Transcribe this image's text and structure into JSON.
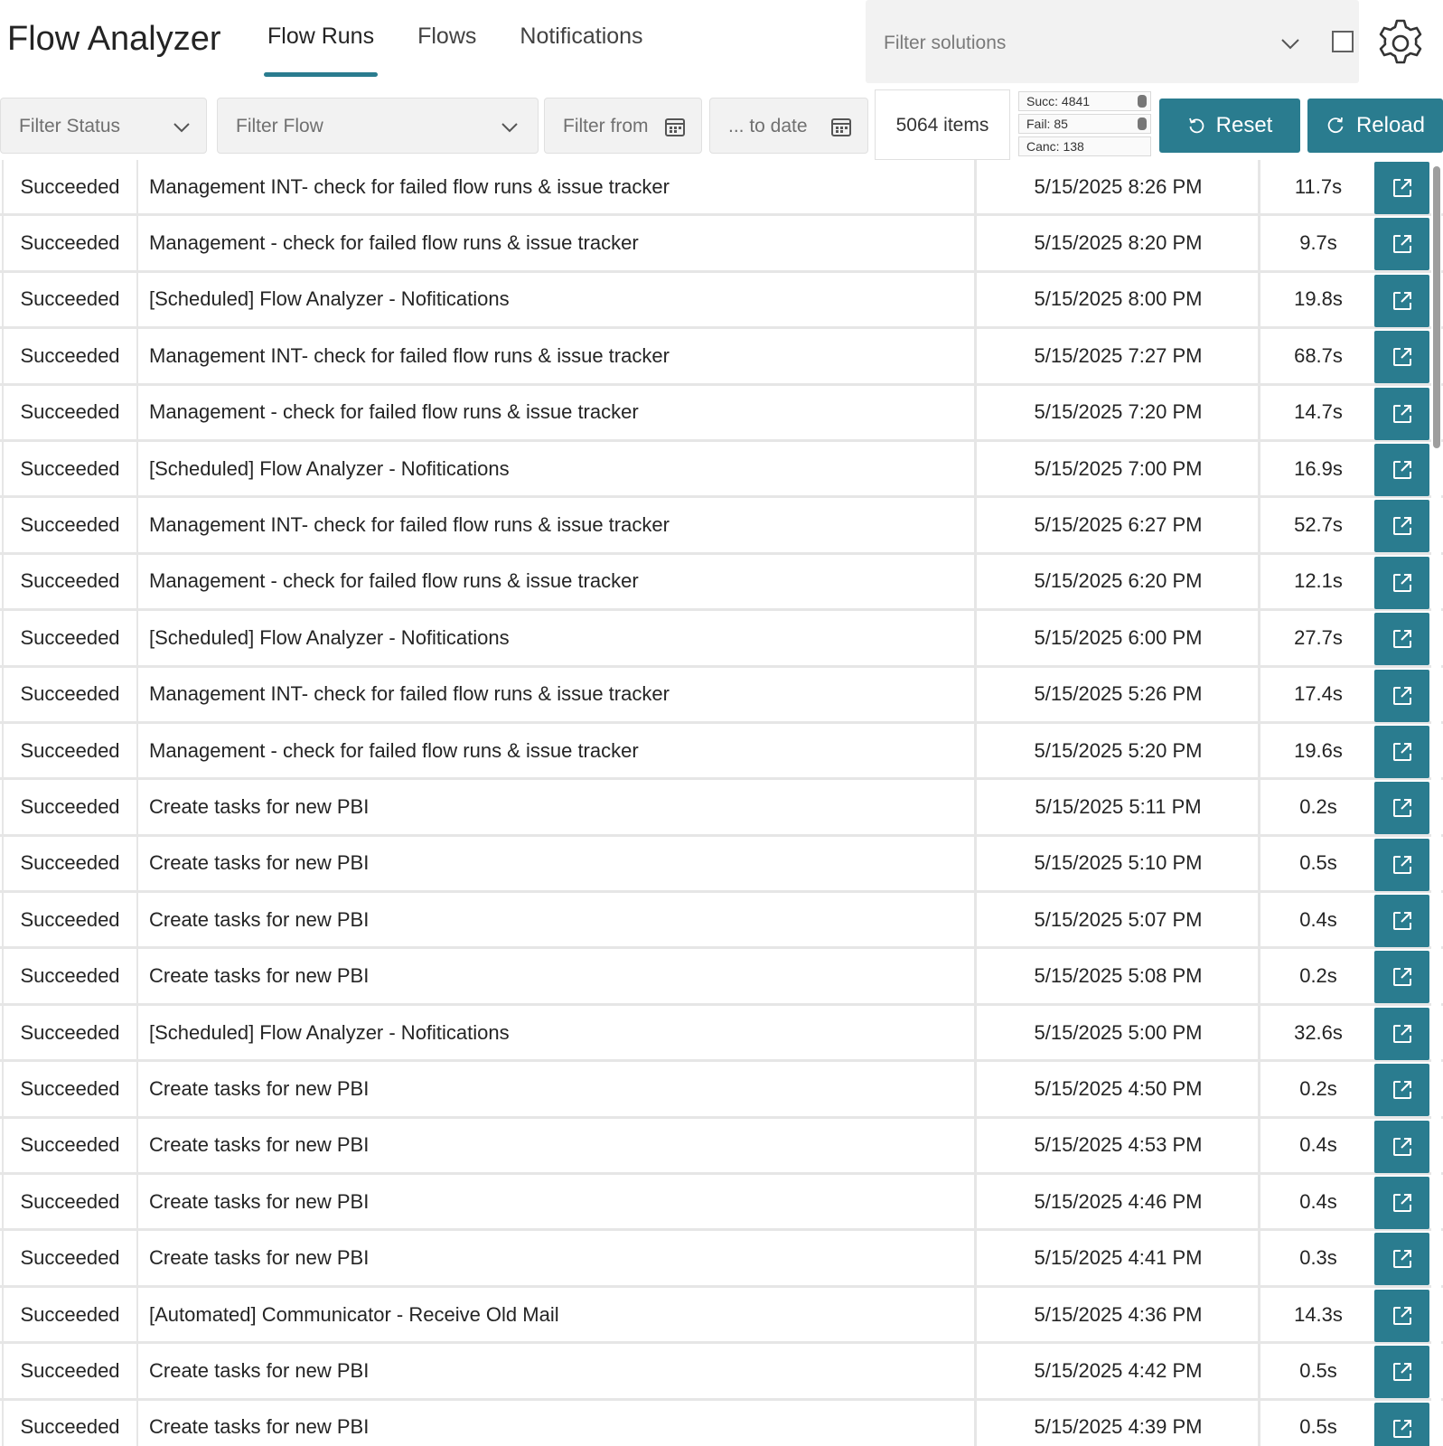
{
  "app": {
    "title": "Flow Analyzer"
  },
  "tabs": [
    {
      "label": "Flow Runs",
      "active": true
    },
    {
      "label": "Flows",
      "active": false
    },
    {
      "label": "Notifications",
      "active": false
    }
  ],
  "solutions": {
    "placeholder": "Filter solutions"
  },
  "filters": {
    "status_placeholder": "Filter Status",
    "flow_placeholder": "Filter Flow",
    "from_placeholder": "Filter from",
    "to_placeholder": "... to date"
  },
  "summary": {
    "items": "5064 items",
    "succeeded": "Succ: 4841",
    "failed": "Fail: 85",
    "cancelled": "Canc: 138"
  },
  "buttons": {
    "reset": "Reset",
    "reload": "Reload"
  },
  "colors": {
    "accent": "#2a7c8f"
  },
  "runs": [
    {
      "status": "Succeeded",
      "flow": "Management INT- check for failed flow runs & issue tracker",
      "date": "5/15/2025 8:26 PM",
      "duration": "11.7s"
    },
    {
      "status": "Succeeded",
      "flow": "Management - check for failed flow runs & issue tracker",
      "date": "5/15/2025 8:20 PM",
      "duration": "9.7s"
    },
    {
      "status": "Succeeded",
      "flow": "[Scheduled] Flow Analyzer - Nofitications",
      "date": "5/15/2025 8:00 PM",
      "duration": "19.8s"
    },
    {
      "status": "Succeeded",
      "flow": "Management INT- check for failed flow runs & issue tracker",
      "date": "5/15/2025 7:27 PM",
      "duration": "68.7s"
    },
    {
      "status": "Succeeded",
      "flow": "Management - check for failed flow runs & issue tracker",
      "date": "5/15/2025 7:20 PM",
      "duration": "14.7s"
    },
    {
      "status": "Succeeded",
      "flow": "[Scheduled] Flow Analyzer - Nofitications",
      "date": "5/15/2025 7:00 PM",
      "duration": "16.9s"
    },
    {
      "status": "Succeeded",
      "flow": "Management INT- check for failed flow runs & issue tracker",
      "date": "5/15/2025 6:27 PM",
      "duration": "52.7s"
    },
    {
      "status": "Succeeded",
      "flow": "Management - check for failed flow runs & issue tracker",
      "date": "5/15/2025 6:20 PM",
      "duration": "12.1s"
    },
    {
      "status": "Succeeded",
      "flow": "[Scheduled] Flow Analyzer - Nofitications",
      "date": "5/15/2025 6:00 PM",
      "duration": "27.7s"
    },
    {
      "status": "Succeeded",
      "flow": "Management INT- check for failed flow runs & issue tracker",
      "date": "5/15/2025 5:26 PM",
      "duration": "17.4s"
    },
    {
      "status": "Succeeded",
      "flow": "Management - check for failed flow runs & issue tracker",
      "date": "5/15/2025 5:20 PM",
      "duration": "19.6s"
    },
    {
      "status": "Succeeded",
      "flow": "Create tasks for new PBI",
      "date": "5/15/2025 5:11 PM",
      "duration": "0.2s"
    },
    {
      "status": "Succeeded",
      "flow": "Create tasks for new PBI",
      "date": "5/15/2025 5:10 PM",
      "duration": "0.5s"
    },
    {
      "status": "Succeeded",
      "flow": "Create tasks for new PBI",
      "date": "5/15/2025 5:07 PM",
      "duration": "0.4s"
    },
    {
      "status": "Succeeded",
      "flow": "Create tasks for new PBI",
      "date": "5/15/2025 5:08 PM",
      "duration": "0.2s"
    },
    {
      "status": "Succeeded",
      "flow": "[Scheduled] Flow Analyzer - Nofitications",
      "date": "5/15/2025 5:00 PM",
      "duration": "32.6s"
    },
    {
      "status": "Succeeded",
      "flow": "Create tasks for new PBI",
      "date": "5/15/2025 4:50 PM",
      "duration": "0.2s"
    },
    {
      "status": "Succeeded",
      "flow": "Create tasks for new PBI",
      "date": "5/15/2025 4:53 PM",
      "duration": "0.4s"
    },
    {
      "status": "Succeeded",
      "flow": "Create tasks for new PBI",
      "date": "5/15/2025 4:46 PM",
      "duration": "0.4s"
    },
    {
      "status": "Succeeded",
      "flow": "Create tasks for new PBI",
      "date": "5/15/2025 4:41 PM",
      "duration": "0.3s"
    },
    {
      "status": "Succeeded",
      "flow": "[Automated] Communicator - Receive Old Mail",
      "date": "5/15/2025 4:36 PM",
      "duration": "14.3s"
    },
    {
      "status": "Succeeded",
      "flow": "Create tasks for new PBI",
      "date": "5/15/2025 4:42 PM",
      "duration": "0.5s"
    },
    {
      "status": "Succeeded",
      "flow": "Create tasks for new PBI",
      "date": "5/15/2025 4:39 PM",
      "duration": "0.5s"
    }
  ]
}
